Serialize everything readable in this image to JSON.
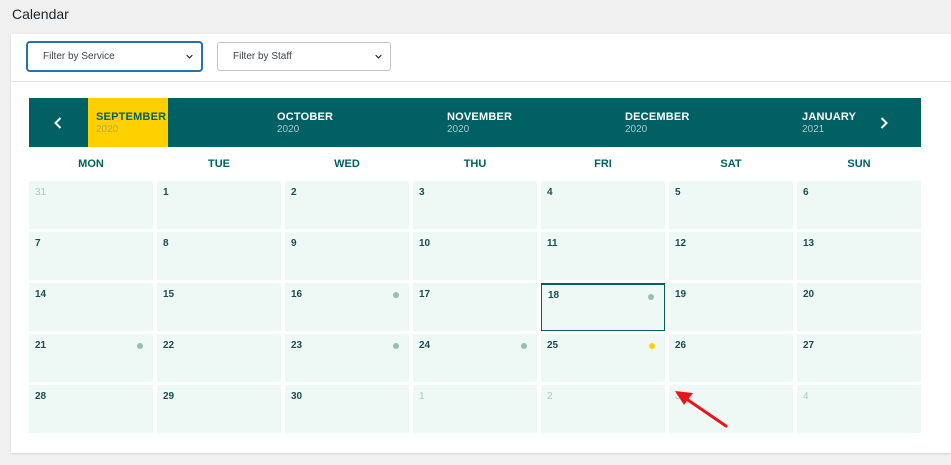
{
  "page": {
    "title": "Calendar"
  },
  "filters": {
    "service_label": "Filter by Service",
    "staff_label": "Filter by Staff"
  },
  "months": [
    {
      "name": "SEPTEMBER",
      "year": "2020",
      "selected": true
    },
    {
      "name": "OCTOBER",
      "year": "2020",
      "selected": false
    },
    {
      "name": "NOVEMBER",
      "year": "2020",
      "selected": false
    },
    {
      "name": "DECEMBER",
      "year": "2020",
      "selected": false
    },
    {
      "name": "JANUARY",
      "year": "2021",
      "selected": false
    }
  ],
  "weekdays": [
    "MON",
    "TUE",
    "WED",
    "THU",
    "FRI",
    "SAT",
    "SUN"
  ],
  "weeks": [
    [
      {
        "d": "31",
        "other": true
      },
      {
        "d": "1"
      },
      {
        "d": "2"
      },
      {
        "d": "3"
      },
      {
        "d": "4"
      },
      {
        "d": "5"
      },
      {
        "d": "6"
      }
    ],
    [
      {
        "d": "7"
      },
      {
        "d": "8"
      },
      {
        "d": "9"
      },
      {
        "d": "10"
      },
      {
        "d": "11"
      },
      {
        "d": "12"
      },
      {
        "d": "13"
      }
    ],
    [
      {
        "d": "14"
      },
      {
        "d": "15"
      },
      {
        "d": "16",
        "dot": "avail"
      },
      {
        "d": "17"
      },
      {
        "d": "18",
        "dot": "avail",
        "today": true
      },
      {
        "d": "19"
      },
      {
        "d": "20"
      }
    ],
    [
      {
        "d": "21",
        "dot": "avail"
      },
      {
        "d": "22"
      },
      {
        "d": "23",
        "dot": "avail"
      },
      {
        "d": "24",
        "dot": "avail"
      },
      {
        "d": "25",
        "dot": "highlight"
      },
      {
        "d": "26"
      },
      {
        "d": "27"
      }
    ],
    [
      {
        "d": "28"
      },
      {
        "d": "29"
      },
      {
        "d": "30"
      },
      {
        "d": "1",
        "other": true
      },
      {
        "d": "2",
        "other": true
      },
      {
        "d": "3",
        "other": true
      },
      {
        "d": "4",
        "other": true
      }
    ]
  ],
  "colors": {
    "header_bg": "#006064",
    "selected_month": "#ffd000",
    "cell_bg": "#eef8f5",
    "dot_available": "#92c2b5",
    "dot_highlight": "#ffd000",
    "annotation_arrow": "#e8161b"
  },
  "icons": {
    "prev": "chevron-left-icon",
    "next": "chevron-right-icon",
    "dropdown": "chevron-down-icon"
  }
}
